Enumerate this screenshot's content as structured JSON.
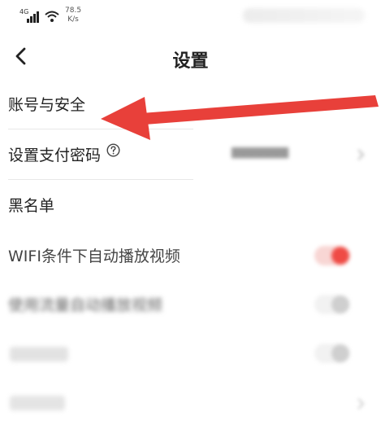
{
  "status_bar": {
    "network": "4G",
    "speed_value": "78.5",
    "speed_unit": "K/s"
  },
  "header": {
    "title": "设置"
  },
  "settings": {
    "account_security": "账号与安全",
    "payment_password": "设置支付密码",
    "blacklist": "黑名单",
    "wifi_autoplay": "WIFI条件下自动播放视频",
    "mobile_autoplay": "使用流量自动播放视频",
    "row6": "",
    "row7": ""
  },
  "toggles": {
    "wifi_autoplay_on": true,
    "mobile_autoplay_on": false
  },
  "colors": {
    "accent_red": "#e8403a",
    "toggle_on": "#ef4b45"
  },
  "icons": [
    "back-arrow-icon",
    "help-circle-icon",
    "signal-icon",
    "wifi-icon",
    "chevron-right-icon"
  ]
}
